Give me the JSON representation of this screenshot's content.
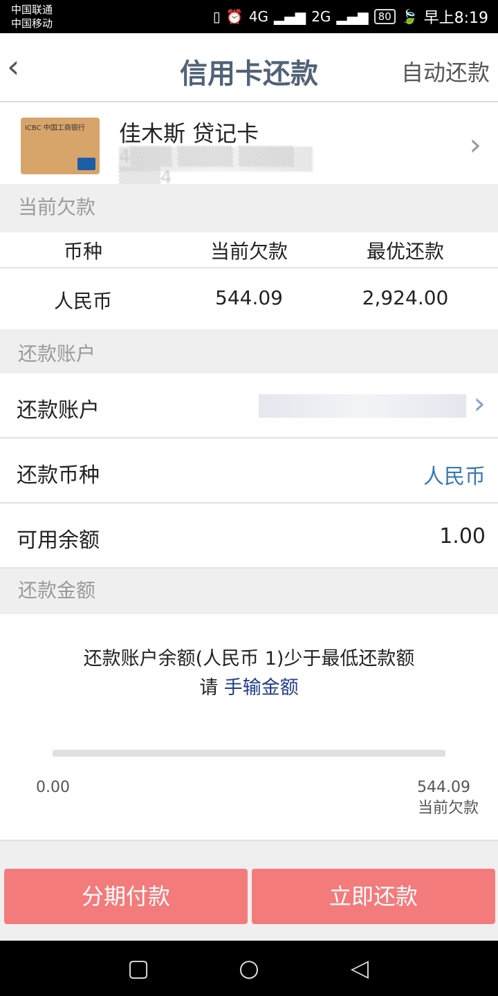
{
  "status_bar": {
    "carrier1": "中国联通",
    "carrier2": "中国移动",
    "network1": "4G",
    "network2": "2G",
    "battery": "80",
    "time": "早上8:19"
  },
  "header": {
    "title": "信用卡还款",
    "auto_label": "自动还款"
  },
  "card": {
    "name": "佳木斯 贷记卡",
    "number_masked": "4▒▒▒ ▒▒▒▒ ▒▒▒▒ ▒▒▒4",
    "bank_label": "ICBC 中国工商银行"
  },
  "debt_section": {
    "label": "当前欠款"
  },
  "debt_table": {
    "columns": [
      "币种",
      "当前欠款",
      "最优还款"
    ],
    "row": [
      "人民币",
      "544.09",
      "2,924.00"
    ]
  },
  "account_section": {
    "label": "还款账户"
  },
  "account": {
    "account_label": "还款账户",
    "currency_label": "还款币种",
    "currency_value": "人民币",
    "balance_label": "可用余额",
    "balance_value": "1.00"
  },
  "amount_section": {
    "label": "还款金额"
  },
  "amount": {
    "message1": "还款账户余额(人民币 1)少于最低还款额",
    "message2_prefix": "请",
    "message2_link": "手输金额",
    "min": "0.00",
    "max": "544.09",
    "max_label": "当前欠款",
    "fill_fraction": 0
  },
  "buttons": {
    "installment": "分期付款",
    "pay_now": "立即还款"
  },
  "colors": {
    "accent": "#f47b7b",
    "link": "#1f3d8a",
    "currency": "#3a78b8"
  }
}
